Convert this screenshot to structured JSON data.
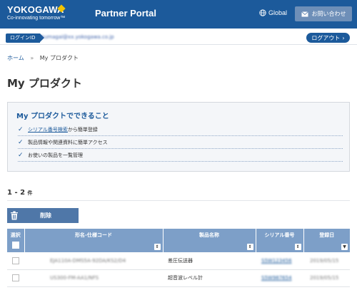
{
  "header": {
    "logo_text": "YOKOGAWA",
    "logo_tagline": "Co-innovating tomorrow™",
    "portal_title": "Partner Portal",
    "global_label": "Global",
    "contact_label": "お問い合わせ",
    "icons": [
      "globe-icon",
      "mail-icon"
    ]
  },
  "login": {
    "label": "ログインID",
    "email": "kumagai@xx.yokogawa.co.jp",
    "logout_label": "ログアウト"
  },
  "breadcrumb": {
    "home": "ホーム",
    "separator": "»",
    "current": "My プロダクト"
  },
  "page": {
    "title": "My プロダクト"
  },
  "info": {
    "heading": "My プロダクトでできること",
    "items": [
      {
        "link": "シリアル番号検索",
        "text": "から簡単登録"
      },
      {
        "link": "",
        "text": "製品情報や関連資料に簡単アクセス"
      },
      {
        "link": "",
        "text": "お使いの製品を一覧管理"
      }
    ]
  },
  "list": {
    "count": "1 - 2",
    "count_unit": "件",
    "delete_label": "削除"
  },
  "table": {
    "headers": {
      "select": "選択",
      "model": "形名-仕様コード",
      "name": "製品名称",
      "serial": "シリアル番号",
      "date": "登録日"
    },
    "rows": [
      {
        "model": "EJA110A-DMS5A-92DA/KS2/D4",
        "name": "差圧伝送器",
        "serial": "S5W123456",
        "date": "2019/05/15"
      },
      {
        "model": "US300-FM-AA1/NFS",
        "name": "超音波レベル計",
        "serial": "S5W987654",
        "date": "2019/05/15"
      }
    ]
  },
  "colors": {
    "brand": "#1c5a9b",
    "accent": "#f2c300",
    "table_header": "#7d9fc8"
  }
}
